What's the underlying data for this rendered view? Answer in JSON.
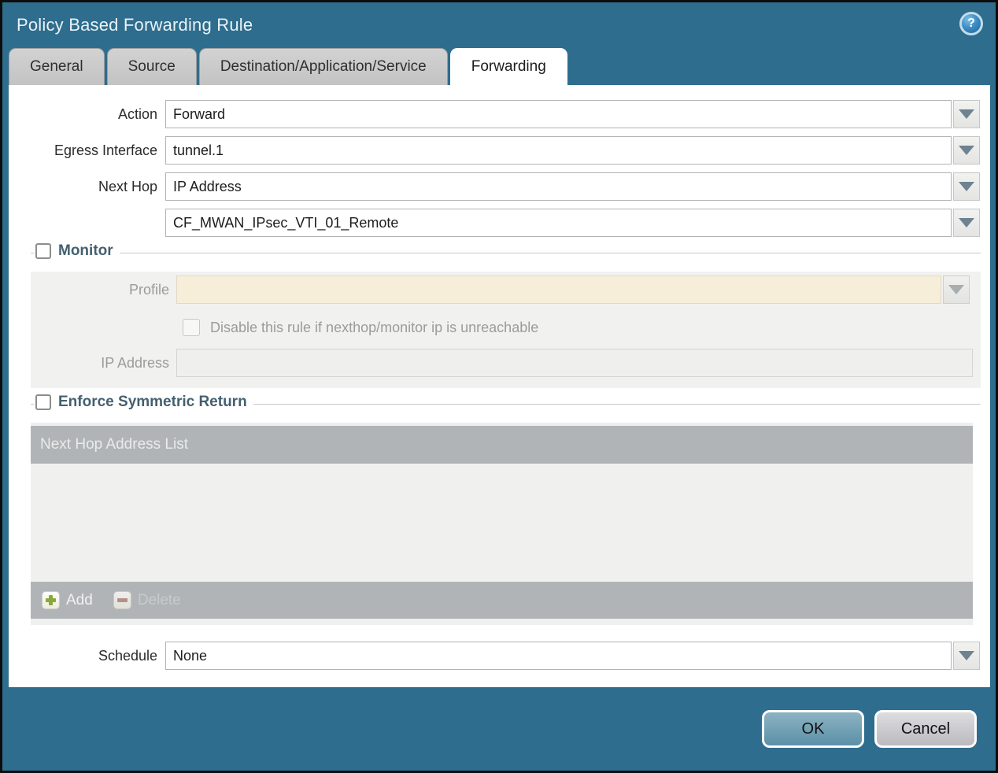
{
  "dialog": {
    "title": "Policy Based Forwarding Rule"
  },
  "tabs": [
    {
      "label": "General",
      "active": false
    },
    {
      "label": "Source",
      "active": false
    },
    {
      "label": "Destination/Application/Service",
      "active": false
    },
    {
      "label": "Forwarding",
      "active": true
    }
  ],
  "form": {
    "action": {
      "label": "Action",
      "value": "Forward"
    },
    "egress_interface": {
      "label": "Egress Interface",
      "value": "tunnel.1"
    },
    "next_hop": {
      "label": "Next Hop",
      "value": "IP Address"
    },
    "next_hop_value": {
      "value": "CF_MWAN_IPsec_VTI_01_Remote"
    },
    "schedule": {
      "label": "Schedule",
      "value": "None"
    }
  },
  "monitor": {
    "label": "Monitor",
    "checked": false,
    "profile_label": "Profile",
    "profile_value": "",
    "disable_rule_label": "Disable this rule if nexthop/monitor ip is unreachable",
    "disable_rule_checked": false,
    "ip_address_label": "IP Address",
    "ip_address_value": ""
  },
  "symmetric_return": {
    "label": "Enforce Symmetric Return",
    "checked": false,
    "table_header": "Next Hop Address List",
    "rows": [],
    "add_label": "Add",
    "delete_label": "Delete"
  },
  "footer": {
    "ok_label": "OK",
    "cancel_label": "Cancel"
  },
  "icons": {
    "help": "help-icon",
    "dropdown": "chevron-down-icon",
    "add": "plus-icon",
    "delete": "minus-icon"
  },
  "colors": {
    "frame_teal": "#2e6d8d",
    "tab_inactive": "#c9c9c9",
    "section_label_text": "#44606f",
    "table_gray": "#b1b4b6",
    "profile_disabled_bg": "#f6eed9",
    "ok_button": "#5b90a7",
    "cancel_button": "#bbbbbf",
    "add_plus_green": "#8aa93c",
    "delete_minus_red": "#a2625a"
  }
}
